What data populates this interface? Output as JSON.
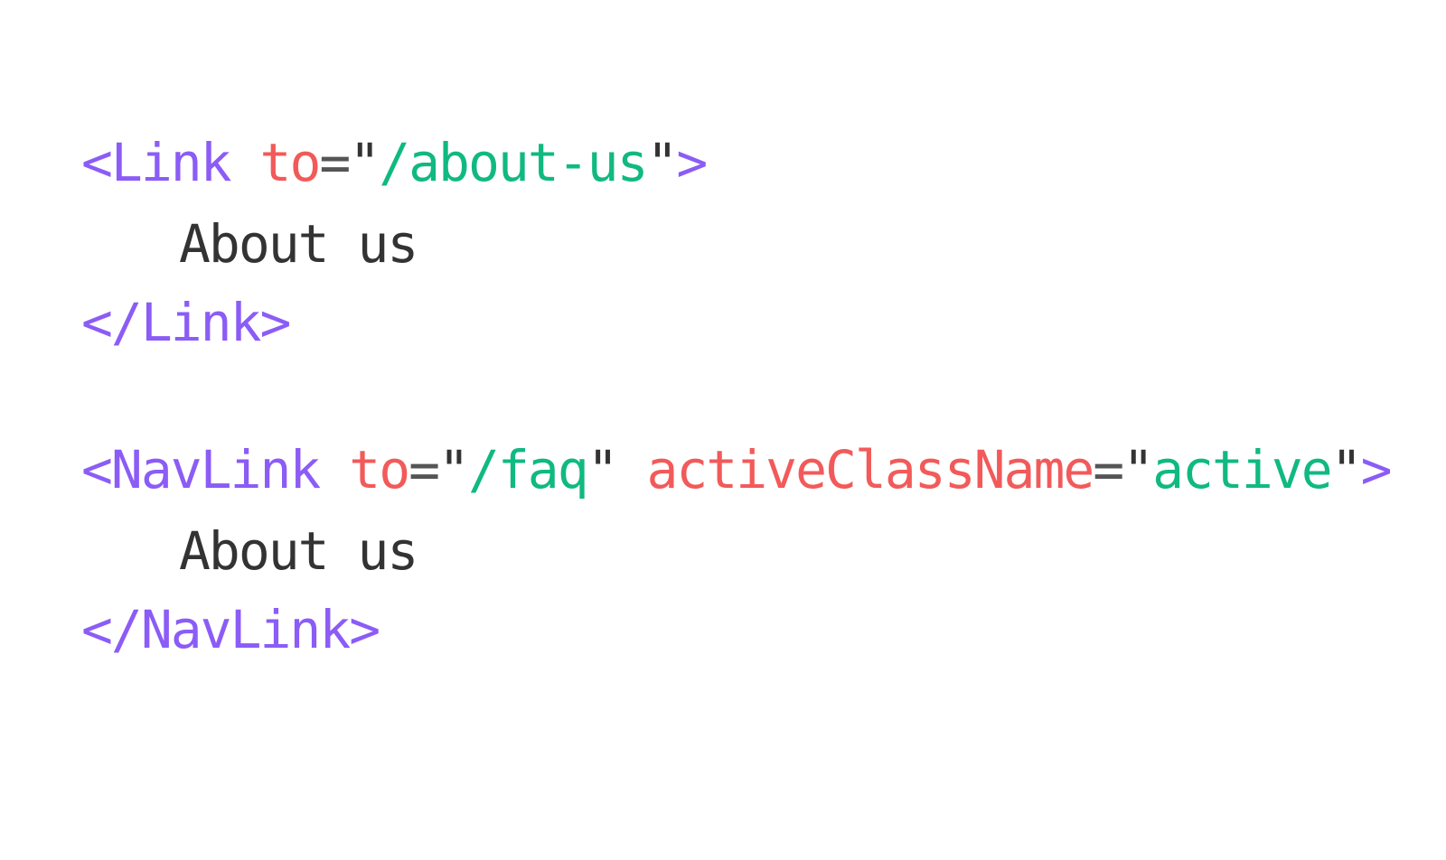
{
  "colors": {
    "background": "#ffffff",
    "tag": "#8b5cf6",
    "attribute": "#f25a5a",
    "string": "#10b981",
    "text": "#333333",
    "operator": "#555555"
  },
  "block1": {
    "open_tag": "<Link",
    "attr_to": "to",
    "eq": "=",
    "quote": "\"",
    "to_value": "/about-us",
    "close_bracket": ">",
    "inner_text": "About us",
    "close_tag": "</Link>"
  },
  "block2": {
    "open_tag": "<NavLink",
    "attr_to": "to",
    "eq": "=",
    "quote": "\"",
    "to_value": "/faq",
    "attr_active": "activeClassName",
    "active_value": "active",
    "close_bracket": ">",
    "inner_text": "About us",
    "close_tag": "</NavLink>"
  }
}
